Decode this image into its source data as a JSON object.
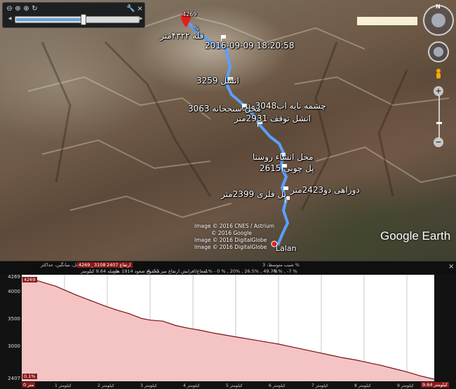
{
  "toolbar": {
    "icons": [
      "zoom-out-icon",
      "zoom-in-icon",
      "zoom-fit-icon",
      "refresh-icon",
      "wrench-icon",
      "close-icon"
    ],
    "slider_position": 0.55
  },
  "nav": {
    "north_label": "N"
  },
  "map_labels": {
    "summit_top": "4269",
    "summit_pct": "%",
    "summit_alt": "قله ۴۳۲۲متر",
    "timestamp": "2016-09-09 18:20:58",
    "l3259": "انشل 3259",
    "l3048": "چشمه نایه اب3048متر",
    "l3063": "محل سنجحانه 3063",
    "l2931": "انشل توقف 2931متر",
    "l_village": "محل انشاء روستا",
    "l2615": "پل چوبی 2615",
    "l2423": "دوراهی دو2423متر",
    "l2399": "پل فلزی 2399متر",
    "town": "Lalan"
  },
  "attribution": [
    "Image © 2016 CNES / Astrium",
    "© 2016 Google",
    "Image © 2016 DigitalGlobe",
    "Image © 2016 DigitalGlobe"
  ],
  "brand": "Google Earth",
  "profile": {
    "header": {
      "left_field": "حداقل، میانگین، حداکثر",
      "red_a": "4269 متر",
      "red_b": "3108",
      "red_c": "2407 ارتفاع",
      "row2_a": "فاصله 9.64 کیلومتر",
      "row2_b": "مجموع صعود 1914 متر",
      "row2_c": "4 :53 میز",
      "row2_d": "شعاع/افزایش ارتفاع",
      "slope_label": "شیب متوسط: 3 %",
      "slope_vals": "-1% - 0 % , 20% , 26.5% , 49.7%",
      "slope_neg": "-0 % , -7 %"
    },
    "close": "×",
    "max_tag": "4269",
    "pct_tag": "0.1%",
    "x_left": "0 متر",
    "x_right": "9.64 کیلومتر"
  },
  "chart_data": {
    "type": "area",
    "title": "",
    "xlabel": "",
    "ylabel": "",
    "x_unit": "کیلومتر",
    "y_unit": "متر",
    "ylim": [
      2407,
      4269
    ],
    "xlim": [
      0,
      9.64
    ],
    "y_ticks": [
      2407,
      3000,
      3500,
      4000,
      4269
    ],
    "y_tick_labels": [
      "2407",
      "3000",
      "3500",
      "4000",
      "4269"
    ],
    "x_ticks": [
      1,
      2,
      3,
      4,
      5,
      6,
      7,
      8,
      9
    ],
    "x_tick_labels": [
      "1 کیلومتر",
      "2 کیلومتر",
      "3 کیلومتر",
      "4 کیلومتر",
      "5 کیلومتر",
      "6 کیلومتر",
      "7 کیلومتر",
      "8 کیلومتر",
      "9 کیلومتر"
    ],
    "grid": true,
    "fill_color": "#f4c4c4",
    "line_color": "#7a1010",
    "series": [
      {
        "x": [
          0,
          0.2,
          0.5,
          0.8,
          1.0,
          1.3,
          1.6,
          1.9,
          2.2,
          2.5,
          2.8,
          3.0,
          3.3,
          3.6,
          3.9,
          4.2,
          4.5,
          4.8,
          5.1,
          5.4,
          5.7,
          6.0,
          6.3,
          6.6,
          6.9,
          7.2,
          7.5,
          7.8,
          8.1,
          8.4,
          8.7,
          9.0,
          9.3,
          9.64
        ],
        "values": [
          4269,
          4250,
          4180,
          4110,
          4040,
          3940,
          3850,
          3760,
          3680,
          3610,
          3520,
          3490,
          3470,
          3390,
          3340,
          3300,
          3250,
          3210,
          3170,
          3130,
          3090,
          3050,
          3000,
          2950,
          2900,
          2850,
          2800,
          2760,
          2710,
          2660,
          2600,
          2540,
          2470,
          2407
        ]
      }
    ]
  }
}
